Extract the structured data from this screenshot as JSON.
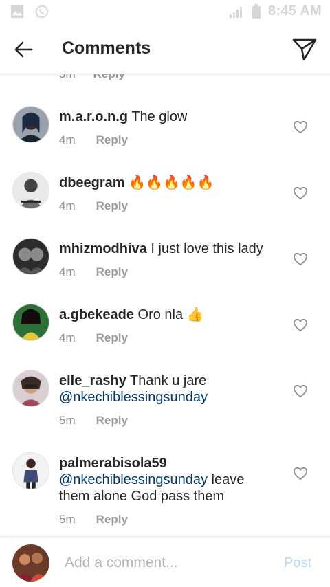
{
  "status_bar": {
    "time": "8:45 AM",
    "left_icons": [
      "gallery-icon",
      "whatsapp-icon"
    ],
    "right_icons": [
      "signal-icon",
      "battery-icon"
    ]
  },
  "header": {
    "title": "Comments",
    "back_icon": "arrow-left-icon",
    "send_icon": "paper-plane-icon"
  },
  "partial_row": {
    "time": "3m",
    "reply": "Reply"
  },
  "comments": [
    {
      "user": "m.a.r.o.n.g",
      "text": " The glow",
      "time": "4m",
      "reply": "Reply"
    },
    {
      "user": "dbeegram",
      "text": " 🔥🔥🔥🔥🔥",
      "time": "4m",
      "reply": "Reply"
    },
    {
      "user": "mhizmodhiva",
      "text": " I just love this lady",
      "time": "4m",
      "reply": "Reply"
    },
    {
      "user": "a.gbekeade",
      "text": " Oro nla 👍",
      "time": "4m",
      "reply": "Reply"
    },
    {
      "user": "elle_rashy",
      "text": " Thank u jare",
      "mention": "@nkechiblessingsunday",
      "text_after": "",
      "time": "5m",
      "reply": "Reply"
    },
    {
      "user": "palmerabisola59",
      "text": "",
      "mention": "@nkechiblessingsunday",
      "text_after": " leave them alone God pass them",
      "time": "5m",
      "reply": "Reply"
    }
  ],
  "footer": {
    "placeholder": "Add a comment...",
    "post_label": "Post"
  },
  "colors": {
    "text": "#262626",
    "secondary": "#8e8e8e",
    "mention": "#003569",
    "post_disabled": "#b3d7f5"
  }
}
